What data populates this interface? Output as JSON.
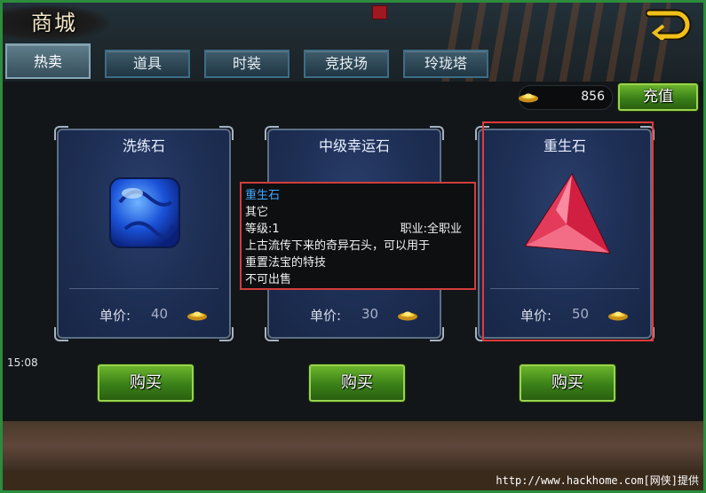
{
  "header": {
    "title": "商城"
  },
  "tabs": [
    {
      "label": "热卖",
      "active": true
    },
    {
      "label": "道具",
      "active": false
    },
    {
      "label": "时装",
      "active": false
    },
    {
      "label": "竞技场",
      "active": false
    },
    {
      "label": "玲珑塔",
      "active": false
    }
  ],
  "currency": {
    "icon": "gold-ingot-icon",
    "amount": "856",
    "recharge_label": "充值"
  },
  "items": [
    {
      "name": "洗练石",
      "price_label": "单价:",
      "price": "40",
      "buy_label": "购买",
      "icon": "blue-gem-icon"
    },
    {
      "name": "中级幸运石",
      "price_label": "单价:",
      "price": "30",
      "buy_label": "购买",
      "icon": "lucky-stone-icon"
    },
    {
      "name": "重生石",
      "price_label": "单价:",
      "price": "50",
      "buy_label": "购买",
      "icon": "red-crystal-icon"
    }
  ],
  "tooltip": {
    "name": "重生石",
    "type": "其它",
    "level": "等级:1",
    "job": "职业:全职业",
    "desc_line1": "上古流传下来的奇异石头，可以用于",
    "desc_line2": "重置法宝的特技",
    "note": "不可出售"
  },
  "status": {
    "time": "15:08"
  },
  "watermark": "http://www.hackhome.com[网侠]提供",
  "colors": {
    "frame_green": "#2c8c3c",
    "highlight_red": "#e23a3a",
    "tooltip_name": "#43a8ff"
  }
}
